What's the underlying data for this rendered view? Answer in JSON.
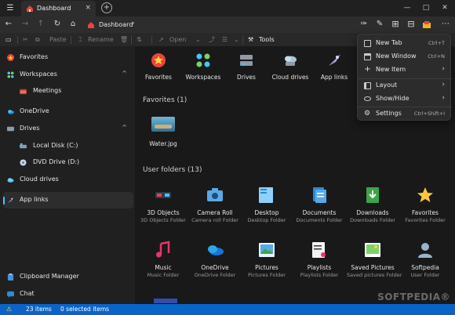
{
  "titlebar": {
    "tab_title": "Dashboard",
    "tab_close": "×",
    "new_tab": "+",
    "minimize": "—",
    "maximize": "□",
    "close": "✕"
  },
  "nav": {
    "breadcrumb": "Dashboard",
    "breadcrumb_chevron": "›"
  },
  "toolbar": {
    "paste": "Paste",
    "rename": "Rename",
    "open": "Open",
    "tools": "Tools"
  },
  "sidebar": {
    "items": [
      {
        "label": "Favorites",
        "icon": "favorites-star-icon"
      },
      {
        "label": "Workspaces",
        "icon": "workspaces-icon",
        "caret": "^"
      },
      {
        "label": "Meetings",
        "icon": "meetings-folder-icon"
      },
      {
        "label": "OneDrive",
        "icon": "onedrive-icon"
      },
      {
        "label": "Drives",
        "icon": "drives-icon",
        "caret": "^"
      },
      {
        "label": "Local Disk (C:)",
        "icon": "local-disk-icon"
      },
      {
        "label": "DVD Drive (D:)",
        "icon": "dvd-drive-icon"
      },
      {
        "label": "Cloud drives",
        "icon": "cloud-drives-icon"
      },
      {
        "label": "App links",
        "icon": "app-links-icon"
      },
      {
        "label": "Clipboard Manager",
        "icon": "clipboard-icon"
      },
      {
        "label": "Chat",
        "icon": "chat-icon"
      }
    ]
  },
  "widgets": [
    {
      "label": "Favorites"
    },
    {
      "label": "Workspaces"
    },
    {
      "label": "Drives"
    },
    {
      "label": "Cloud drives"
    },
    {
      "label": "App links"
    }
  ],
  "favorites_section": {
    "title": "Favorites  (1)",
    "file_name": "Water.jpg"
  },
  "user_folders": {
    "title": "User folders  (13)",
    "items": [
      {
        "name": "3D Objects",
        "sub": "3D Objects Folder"
      },
      {
        "name": "Camera Roll",
        "sub": "Camera roll Folder"
      },
      {
        "name": "Desktop",
        "sub": "Desktop Folder"
      },
      {
        "name": "Documents",
        "sub": "Documents Folder"
      },
      {
        "name": "Downloads",
        "sub": "Downloads Folder"
      },
      {
        "name": "Favorites",
        "sub": "Favorites Folder"
      },
      {
        "name": "Music",
        "sub": "Music Folder"
      },
      {
        "name": "OneDrive",
        "sub": "OneDrive Folder"
      },
      {
        "name": "Pictures",
        "sub": "Pictures Folder"
      },
      {
        "name": "Playlists",
        "sub": "Playlists Folder"
      },
      {
        "name": "Saved Pictures",
        "sub": "Saved pictures Folder"
      },
      {
        "name": "Softpedia",
        "sub": "User Folder"
      }
    ]
  },
  "menu": {
    "items": [
      {
        "label": "New Tab",
        "shortcut": "Ctrl+T"
      },
      {
        "label": "New Window",
        "shortcut": "Ctrl+N"
      },
      {
        "label": "New Item",
        "arrow": "›"
      },
      {
        "label": "Layout",
        "arrow": "›"
      },
      {
        "label": "Show/Hide",
        "arrow": "›"
      },
      {
        "label": "Settings",
        "shortcut": "Ctrl+Shift+I"
      }
    ]
  },
  "status": {
    "warning": "⚠",
    "items": "23 items",
    "selected": "0 selected items"
  },
  "watermark": "SOFTPEDIA®",
  "colors": {
    "accent": "#4cc2ff",
    "statusbar": "#0a64c8"
  }
}
